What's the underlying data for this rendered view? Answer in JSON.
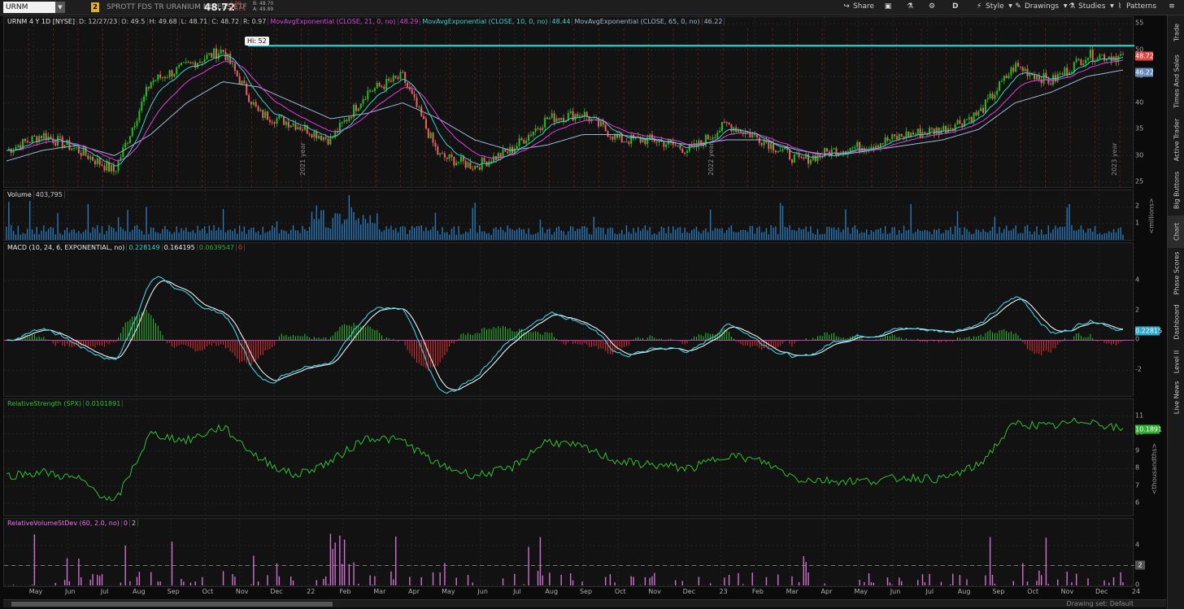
{
  "toolbar": {
    "symbol": "URNM",
    "link_number": "2",
    "description": "SPROTT FDS TR URANIUM MINERS ETF",
    "last": "48.72",
    "change": "-1.00",
    "change_pct": "-2.01%",
    "bid": "B: 48.70",
    "ask": "A: 49.89",
    "share": "Share",
    "aggregation": "D",
    "style": "Style",
    "drawings": "Drawings",
    "studies": "Studies",
    "patterns": "Patterns"
  },
  "sidebar": [
    "Trade",
    "Times And Sales",
    "Active Trader",
    "Big Buttons",
    "Chart",
    "Phase Scores",
    "Dashboard",
    "Level II",
    "Live News"
  ],
  "price_panel": {
    "header": [
      "URNM 4 Y 1D [NYSE]",
      "D: 12/27/23",
      "O: 49.5",
      "H: 49.68",
      "L: 48.71",
      "C: 48.72",
      "R: 0.97"
    ],
    "studies": [
      {
        "label": "MovAvgExponential (CLOSE, 21, 0, no)",
        "value": "48.29",
        "color": "#e040e0"
      },
      {
        "label": "MovAvgExponential (CLOSE, 10, 0, no)",
        "value": "48.44",
        "color": "#40d0d0"
      },
      {
        "label": "MovAvgExponential (CLOSE, 65, 0, no)",
        "value": "46.22",
        "color": "#a0b8d8"
      }
    ],
    "hi_label": "Hi: 52",
    "y_ticks": [
      "55",
      "50",
      "45",
      "40",
      "35",
      "30",
      "25"
    ],
    "last_tag": "48.72",
    "ema65_tag": "46.22",
    "year_labels": [
      "2021 year",
      "2022 year",
      "2023 year"
    ]
  },
  "volume_panel": {
    "header": [
      "Volume",
      "403,795"
    ],
    "y_ticks": [
      "2",
      "1"
    ],
    "unit": "<millions>"
  },
  "macd_panel": {
    "header": [
      "MACD (10, 24, 6, EXPONENTIAL, no)",
      "0.228149",
      "0.164195",
      "0.0639547",
      "0"
    ],
    "y_ticks": [
      "4",
      "2",
      "0",
      "-2"
    ],
    "last_tag": "0.22815"
  },
  "rs_panel": {
    "header": [
      "RelativeStrength (SPX)",
      "0.0101891"
    ],
    "y_ticks": [
      "11",
      "10",
      "9",
      "8",
      "7",
      "6"
    ],
    "last_tag": "10.1891",
    "unit": "<thousandths>"
  },
  "rvsd_panel": {
    "header": [
      "RelativeVolumeStDev (60, 2.0, no)",
      "0",
      "2"
    ],
    "y_ticks": [
      "4",
      "2",
      "0"
    ],
    "tag": "2"
  },
  "x_axis": [
    "May",
    "Jun",
    "Jul",
    "Aug",
    "Sep",
    "Oct",
    "Nov",
    "Dec",
    "22",
    "Feb",
    "Mar",
    "Apr",
    "May",
    "Jun",
    "Jul",
    "Aug",
    "Sep",
    "Oct",
    "Nov",
    "Dec",
    "23",
    "Feb",
    "Mar",
    "Apr",
    "May",
    "Jun",
    "Jul",
    "Aug",
    "Sep",
    "Oct",
    "Nov",
    "Dec",
    "24"
  ],
  "footer": {
    "drawing_set": "Drawing set: Default"
  },
  "chart_data": {
    "type": "line",
    "title": "URNM 4 Y 1D [NYSE]",
    "x": [
      "May 2021",
      "Jun",
      "Jul",
      "Aug",
      "Sep",
      "Oct",
      "Nov",
      "Dec",
      "Jan 2022",
      "Feb",
      "Mar",
      "Apr",
      "May",
      "Jun",
      "Jul",
      "Aug",
      "Sep",
      "Oct",
      "Nov",
      "Dec",
      "Jan 2023",
      "Feb",
      "Mar",
      "Apr",
      "May",
      "Jun",
      "Jul",
      "Aug",
      "Sep",
      "Oct",
      "Nov",
      "Dec"
    ],
    "series": [
      {
        "name": "Close",
        "values": [
          31,
          34,
          31,
          27,
          44,
          47,
          50,
          38,
          36,
          33,
          42,
          45,
          30,
          28,
          31,
          37,
          38,
          33,
          33,
          31,
          36,
          33,
          29,
          31,
          32,
          34,
          35,
          38,
          47,
          44,
          49,
          48.72
        ]
      },
      {
        "name": "MovAvgExponential (CLOSE, 65, 0, no)",
        "values": [
          29,
          31,
          32,
          30,
          34,
          40,
          44,
          43,
          40,
          37,
          38,
          40,
          37,
          33,
          31,
          32,
          34,
          34,
          33,
          32,
          33,
          33,
          31,
          30,
          31,
          32,
          33,
          35,
          40,
          42,
          45,
          46.22
        ]
      },
      {
        "name": "RelativeStrength (SPX)",
        "values": [
          7.6,
          7.8,
          7.4,
          6.0,
          10.0,
          9.6,
          10.4,
          8.6,
          7.6,
          8.4,
          9.8,
          9.6,
          8.2,
          7.6,
          8.0,
          9.6,
          9.2,
          8.4,
          8.2,
          8.0,
          8.8,
          8.4,
          7.4,
          7.3,
          7.3,
          7.5,
          7.4,
          8.2,
          10.6,
          10.4,
          10.8,
          10.19
        ]
      }
    ],
    "ylim": [
      25,
      55
    ],
    "grid": true,
    "legend": "top-left"
  }
}
